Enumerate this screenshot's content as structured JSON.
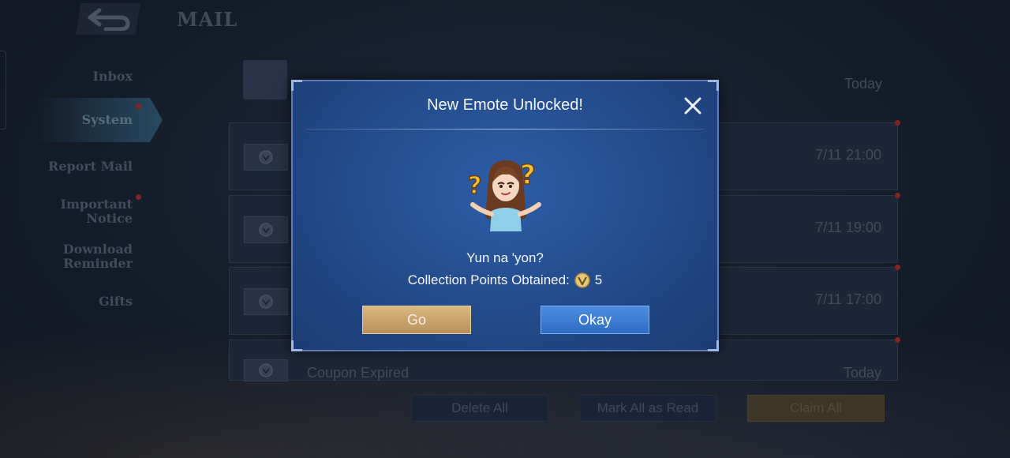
{
  "header": {
    "title": "MAIL",
    "back_icon": "back-arrow-icon"
  },
  "sidebar": {
    "items": [
      {
        "label": "Inbox",
        "active": false,
        "badge": false
      },
      {
        "label": "System",
        "active": true,
        "badge": true
      },
      {
        "label": "Report Mail",
        "active": false,
        "badge": false
      },
      {
        "label": "Important Notice",
        "active": false,
        "badge": true
      },
      {
        "label": "Download Reminder",
        "active": false,
        "badge": false
      },
      {
        "label": "Gifts",
        "active": false,
        "badge": false
      }
    ]
  },
  "mail_list": {
    "rows": [
      {
        "subject": "",
        "time": "Today",
        "icon": "folder-icon"
      },
      {
        "subject": "",
        "time": "7/11 21:00",
        "icon": "mail-emblem-icon"
      },
      {
        "subject": "",
        "time": "7/11 19:00",
        "icon": "mail-emblem-icon"
      },
      {
        "subject": "",
        "time": "7/11 17:00",
        "icon": "mail-emblem-icon"
      },
      {
        "subject": "Coupon Expired",
        "time": "Today",
        "icon": "mail-emblem-icon"
      }
    ]
  },
  "footer": {
    "delete_all": "Delete All",
    "mark_all_read": "Mark All as Read",
    "claim_all": "Claim All"
  },
  "dialog": {
    "title": "New Emote Unlocked!",
    "emote_name": "Yun na 'yon?",
    "points_label": "Collection Points Obtained:",
    "points_value": "5",
    "go_label": "Go",
    "okay_label": "Okay",
    "close_icon": "close-icon",
    "coin_icon": "collection-point-icon"
  },
  "colors": {
    "dialog_bg": "#234a8a",
    "go_button": "#c8a46c",
    "okay_button": "#3d7dd6",
    "badge_red": "#c0302c"
  }
}
